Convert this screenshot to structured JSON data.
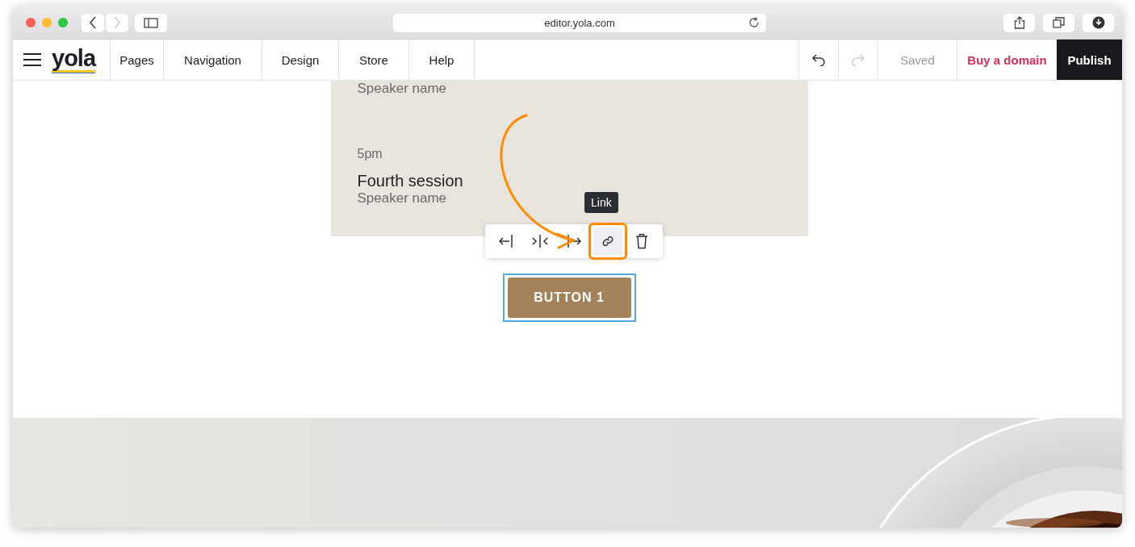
{
  "browser": {
    "url": "editor.yola.com",
    "back_disabled": false,
    "forward_disabled": true
  },
  "editor_nav": {
    "logo": "yola",
    "menu": [
      {
        "label": "Pages"
      },
      {
        "label": "Navigation"
      },
      {
        "label": "Design"
      },
      {
        "label": "Store"
      },
      {
        "label": "Help"
      }
    ],
    "undo": {
      "disabled": false
    },
    "redo": {
      "disabled": true
    },
    "status": {
      "label": "Saved",
      "disabled": true
    },
    "buy_domain": "Buy a domain",
    "publish": "Publish"
  },
  "schedule_block": {
    "items": [
      {
        "kind": "speaker",
        "text": "Speaker name"
      },
      {
        "kind": "time",
        "text": "5pm"
      },
      {
        "kind": "title",
        "text": "Fourth session"
      },
      {
        "kind": "speaker",
        "text": "Speaker name"
      }
    ]
  },
  "element_toolbar": {
    "tools": [
      {
        "kind": "align-left",
        "hovered": false
      },
      {
        "kind": "align-center",
        "hovered": false
      },
      {
        "kind": "align-right",
        "hovered": false
      },
      {
        "kind": "link",
        "hovered": true
      },
      {
        "kind": "delete",
        "hovered": false
      }
    ],
    "tooltip": "Link"
  },
  "button_block": {
    "label": "BUTTON 1",
    "selected": true
  }
}
